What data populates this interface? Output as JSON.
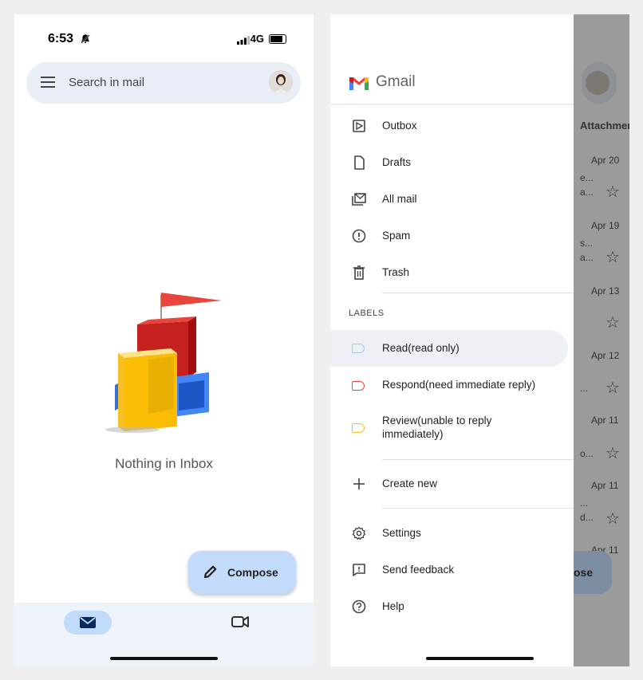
{
  "left_screen": {
    "status": {
      "time": "6:53",
      "network": "4G"
    },
    "search": {
      "placeholder": "Search in mail"
    },
    "empty_state": {
      "message": "Nothing in Inbox"
    },
    "compose": {
      "label": "Compose"
    },
    "bottom_nav": {
      "items": [
        {
          "icon": "mail-icon",
          "active": true
        },
        {
          "icon": "video-icon",
          "active": false
        }
      ]
    }
  },
  "right_screen": {
    "drawer": {
      "app_name": "Gmail",
      "items": [
        {
          "label": "Outbox",
          "icon": "outbox-icon"
        },
        {
          "label": "Drafts",
          "icon": "draft-icon"
        },
        {
          "label": "All mail",
          "icon": "all-mail-icon"
        },
        {
          "label": "Spam",
          "icon": "spam-icon"
        },
        {
          "label": "Trash",
          "icon": "trash-icon"
        }
      ],
      "labels_header": "LABELS",
      "labels": [
        {
          "label": "Read(read only)",
          "color": "#a8c7fa",
          "active": true
        },
        {
          "label": "Respond(need immediate reply)",
          "color": "#e8453c"
        },
        {
          "label": "Review(unable to reply immediately)",
          "color": "#f6bf26"
        }
      ],
      "create_new": "Create new",
      "footer_items": [
        {
          "label": "Settings",
          "icon": "settings-icon"
        },
        {
          "label": "Send feedback",
          "icon": "feedback-icon"
        },
        {
          "label": "Help",
          "icon": "help-icon"
        }
      ]
    },
    "background": {
      "column_header": "Attachmer",
      "dates": [
        "Apr 20",
        "Apr 19",
        "Apr 13",
        "Apr 12",
        "Apr 11",
        "Apr 11",
        "Apr 11"
      ],
      "snippets": [
        "e...",
        "a...",
        "s...",
        "a...",
        "...",
        "o...",
        "...",
        "d..."
      ],
      "compose_fragment": "ose"
    },
    "colors": {
      "accent": "#c2dbfb",
      "scrim": "#9b9b9b"
    }
  }
}
